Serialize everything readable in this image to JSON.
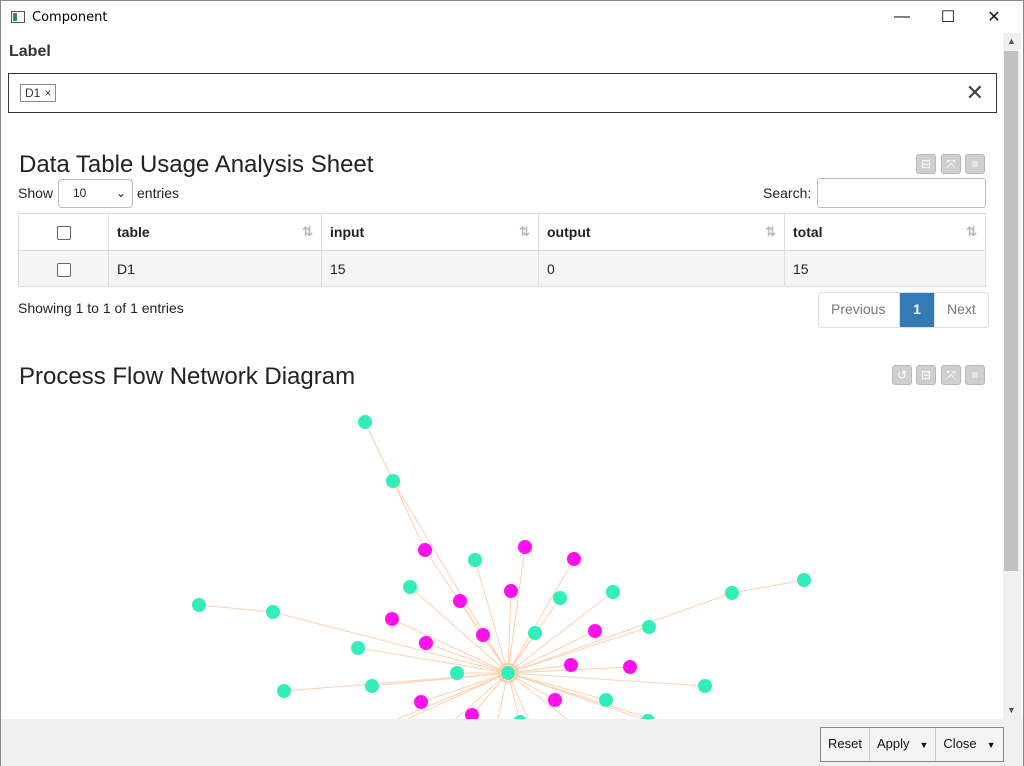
{
  "window": {
    "title": "Component",
    "minimize": "—",
    "maximize": "☐",
    "close": "✕"
  },
  "label_field": {
    "heading": "Label",
    "tags": [
      "D1"
    ],
    "tag_remove": "×",
    "clear": "✕"
  },
  "table_section": {
    "title": "Data Table Usage Analysis Sheet",
    "show_label": "Show",
    "page_size": "10",
    "entries_label": "entries",
    "search_label": "Search:",
    "search_value": "",
    "columns": [
      "table",
      "input",
      "output",
      "total"
    ],
    "rows": [
      {
        "table": "D1",
        "input": "15",
        "output": "0",
        "total": "15"
      }
    ],
    "info": "Showing 1 to 1 of 1 entries",
    "pager": {
      "previous": "Previous",
      "current": "1",
      "next": "Next"
    }
  },
  "graph_section": {
    "title": "Process Flow Network Diagram",
    "colors": {
      "table_node": "#33eebb",
      "process_node": "#ff11ee",
      "edge": "#ffd0b0",
      "center_ring": "#ffcc99"
    }
  },
  "footer": {
    "reset": "Reset",
    "apply": "Apply",
    "close": "Close"
  }
}
